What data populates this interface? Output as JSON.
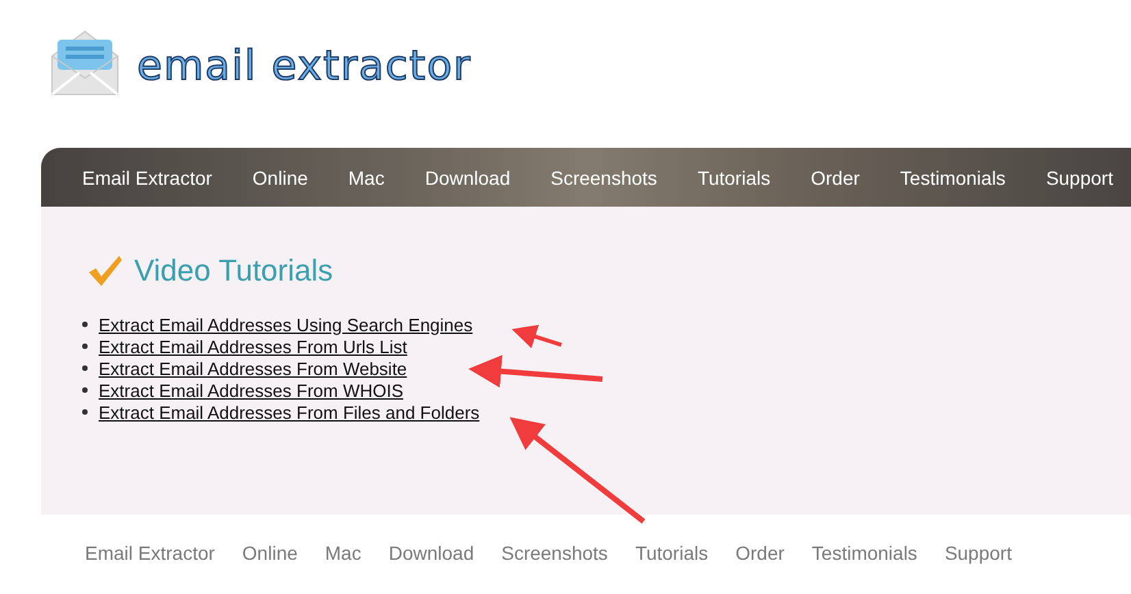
{
  "logo": {
    "text": "email extractor"
  },
  "nav": {
    "items": [
      "Email Extractor",
      "Online",
      "Mac",
      "Download",
      "Screenshots",
      "Tutorials",
      "Order",
      "Testimonials",
      "Support"
    ]
  },
  "content": {
    "title": "Video Tutorials",
    "links": [
      "Extract Email Addresses Using Search Engines",
      "Extract Email Addresses From Urls List",
      "Extract Email Addresses From Website",
      "Extract Email Addresses From WHOIS",
      "Extract Email Addresses From Files and Folders"
    ]
  },
  "footer": {
    "items": [
      "Email Extractor",
      "Online",
      "Mac",
      "Download",
      "Screenshots",
      "Tutorials",
      "Order",
      "Testimonials",
      "Support"
    ]
  }
}
